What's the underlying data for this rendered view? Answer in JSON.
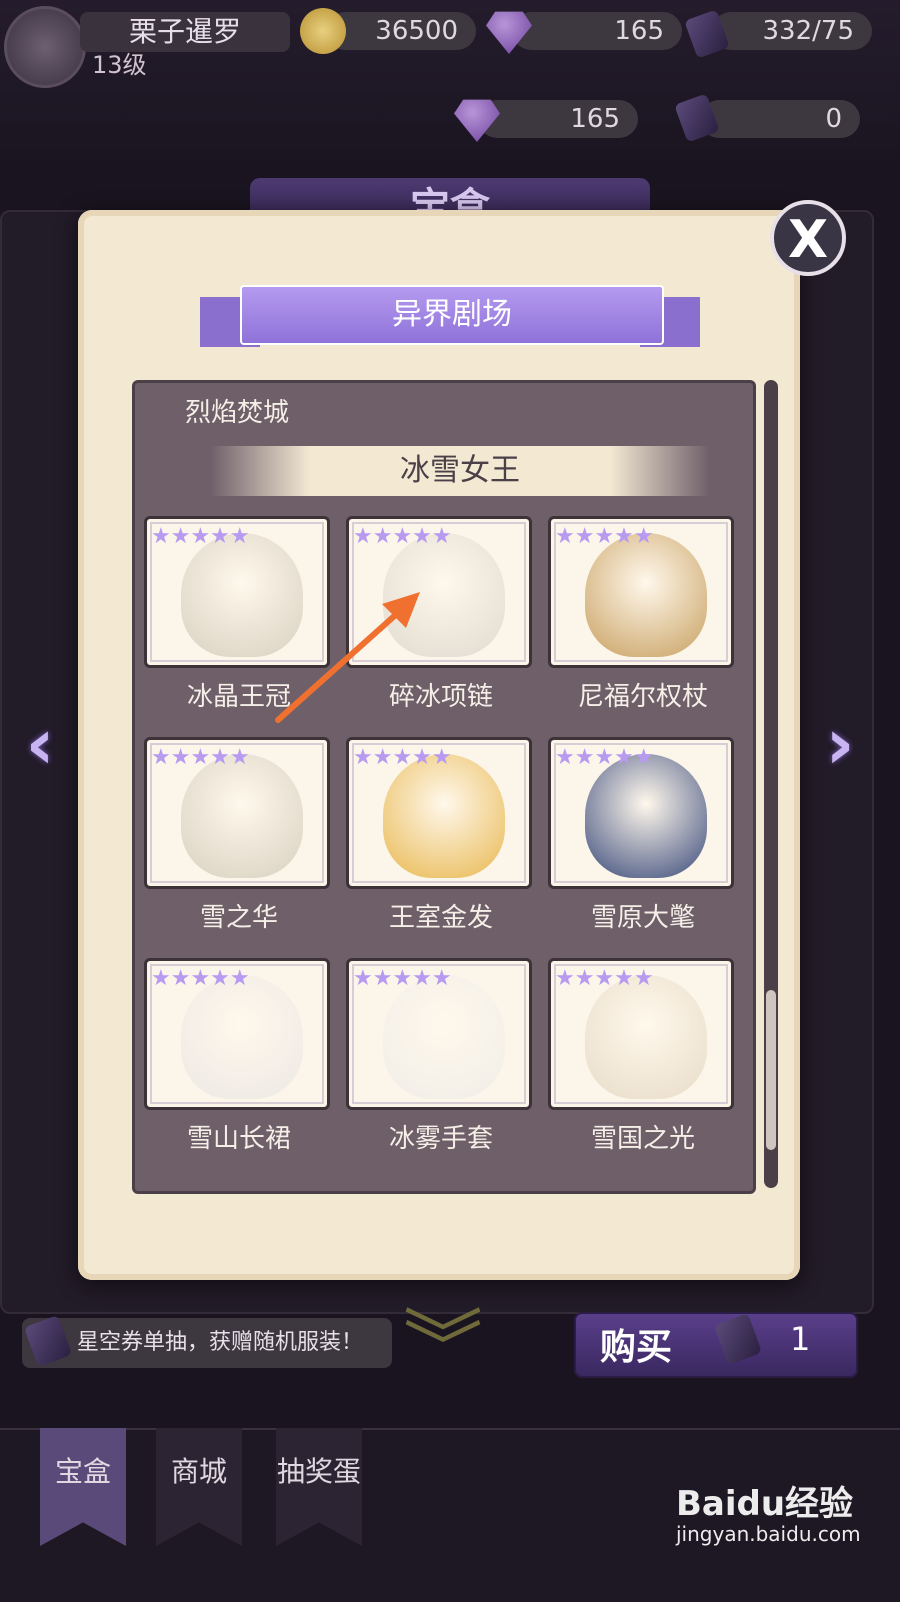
{
  "header": {
    "player_name": "栗子暹罗",
    "player_level": "13级",
    "coins": "36500",
    "gems": "165",
    "stamina": "332/75",
    "shop_gems": "165",
    "shop_tickets": "0",
    "plus": "+"
  },
  "background": {
    "panel_title": "宝盒"
  },
  "popup": {
    "title": "异界剧场",
    "close_label": "X",
    "previous_category": "烈焰焚城",
    "section_title": "冰雪女王",
    "items": [
      {
        "label": "冰晶王冠",
        "stars": 5,
        "icon": "crown-illustration"
      },
      {
        "label": "碎冰项链",
        "stars": 5,
        "icon": "necklace-illustration"
      },
      {
        "label": "尼福尔权杖",
        "stars": 5,
        "icon": "scepter-illustration"
      },
      {
        "label": "雪之华",
        "stars": 5,
        "icon": "earring-illustration"
      },
      {
        "label": "王室金发",
        "stars": 5,
        "icon": "golden-hair-illustration"
      },
      {
        "label": "雪原大氅",
        "stars": 5,
        "icon": "cloak-illustration"
      },
      {
        "label": "雪山长裙",
        "stars": 5,
        "icon": "dress-illustration"
      },
      {
        "label": "冰雾手套",
        "stars": 5,
        "icon": "glove-illustration"
      },
      {
        "label": "雪国之光",
        "stars": 5,
        "icon": "makeup-illustration"
      }
    ],
    "star_glyph": "★"
  },
  "bottom": {
    "hint": "星空券单抽，获赠随机服装！",
    "buy_label": "购买",
    "buy_qty": "1"
  },
  "tabs": [
    "宝盒",
    "商城",
    "抽奖蛋"
  ],
  "watermark": {
    "brand": "Baidu经验",
    "url": "jingyan.baidu.com"
  },
  "colors": {
    "accent": "#9a7fe0",
    "parchment": "#f3e9d3",
    "list_bg": "#6e5f69"
  }
}
